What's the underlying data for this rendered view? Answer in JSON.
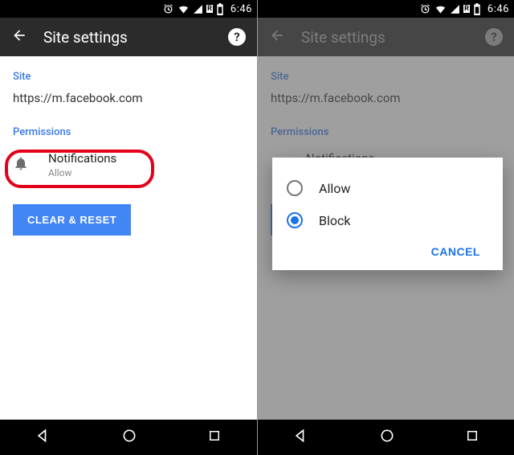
{
  "status": {
    "clock": "6:46"
  },
  "appbar": {
    "title": "Site settings"
  },
  "site": {
    "label": "Site",
    "url": "https://m.facebook.com"
  },
  "permissions": {
    "label": "Permissions",
    "notification": {
      "title": "Notifications",
      "value": "Allow"
    }
  },
  "clear_reset": "CLEAR & RESET",
  "dialog": {
    "allow": "Allow",
    "block": "Block",
    "cancel": "CANCEL"
  }
}
